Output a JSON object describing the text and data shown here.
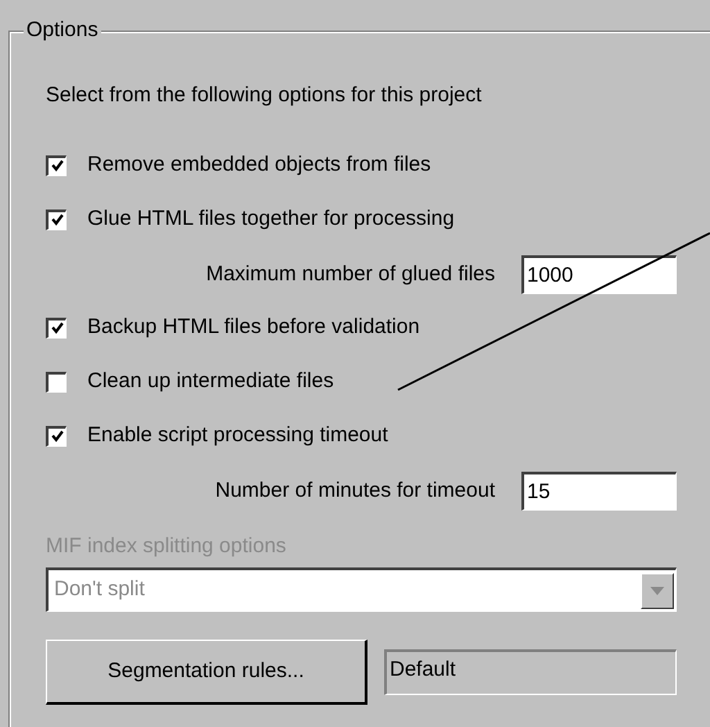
{
  "group": {
    "title": "Options"
  },
  "items": [
    {
      "kind": "text",
      "text": "Select from the following options for this project"
    },
    {
      "kind": "checkbox",
      "label": "Remove embedded objects from files",
      "checked": true
    },
    {
      "kind": "checkbox",
      "label": "Glue HTML files together for processing",
      "checked": true
    },
    {
      "kind": "number",
      "label": "Maximum number of glued files",
      "value": "1000"
    },
    {
      "kind": "checkbox",
      "label": "Backup HTML files before validation",
      "checked": true
    },
    {
      "kind": "checkbox",
      "label": "Clean up intermediate files",
      "checked": false
    },
    {
      "kind": "checkbox",
      "label": "Enable script processing timeout",
      "checked": true
    },
    {
      "kind": "number",
      "label": "Number of minutes for timeout",
      "value": "15"
    }
  ],
  "mif": {
    "label": "MIF index splitting options",
    "value": "Don't split",
    "disabled": true
  },
  "segmentation": {
    "button": "Segmentation rules...",
    "value": "Default"
  }
}
